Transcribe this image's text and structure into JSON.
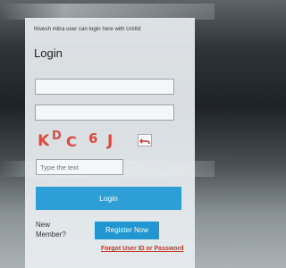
{
  "login_panel": {
    "header_text": "Nivesh mitra user can login here with UnitId",
    "title": "Login",
    "username_value": "",
    "password_value": "",
    "captcha_chars": [
      "K",
      "D",
      "C",
      "6",
      "J"
    ],
    "captcha_placeholder": "Type the text",
    "login_label": "Login",
    "new_member_line1": "New",
    "new_member_line2": "Member?",
    "register_label": "Register Now",
    "forgot_label": "Forgot User ID or Password"
  },
  "colors": {
    "accent_blue": "#2d9fd6",
    "captcha_red": "#d94a3f",
    "link_red": "#c0392b"
  },
  "icons": {
    "refresh": "refresh-icon"
  }
}
